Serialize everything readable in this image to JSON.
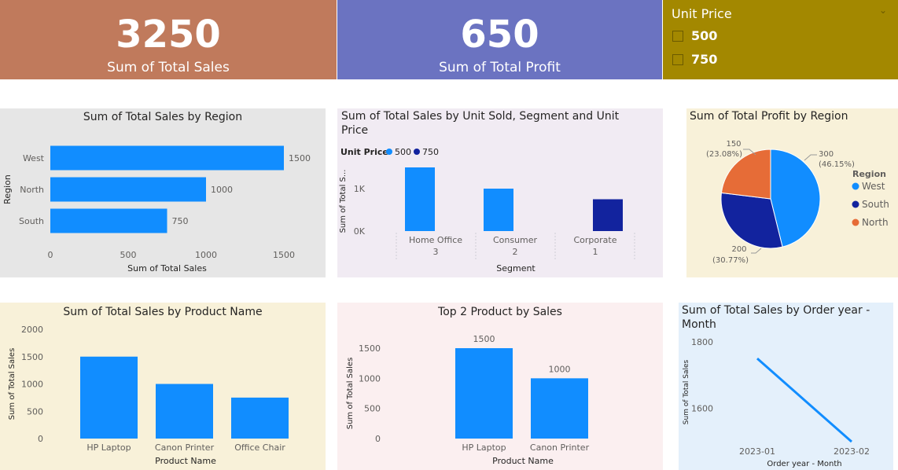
{
  "kpis": [
    {
      "value": "3250",
      "label": "Sum of Total Sales",
      "bg": "#c07a5c"
    },
    {
      "value": "650",
      "label": "Sum of Total Profit",
      "bg": "#6b73c1"
    }
  ],
  "slicer": {
    "title": "Unit Price",
    "items": [
      "500",
      "750"
    ],
    "bg": "#a38800"
  },
  "colors": {
    "blue": "#118dff",
    "dark_blue": "#12239e",
    "orange": "#e66c37"
  },
  "chart_data": [
    {
      "type": "bar",
      "orientation": "horizontal",
      "title": "Sum of Total Sales by Region",
      "categories": [
        "West",
        "North",
        "South"
      ],
      "values": [
        1500,
        1000,
        750
      ],
      "data_labels": [
        "1500",
        "1000",
        "750"
      ],
      "xlabel": "Sum of Total Sales",
      "ylabel": "Region",
      "xticks": [
        "0",
        "500",
        "1000",
        "1500"
      ],
      "xlim": [
        0,
        1500
      ]
    },
    {
      "type": "bar",
      "title": "Sum of Total Sales by Unit Sold, Segment and Unit Price",
      "legend_title": "Unit Price",
      "series": [
        {
          "name": "500",
          "values": [
            1500,
            1000,
            0
          ]
        },
        {
          "name": "750",
          "values": [
            0,
            0,
            750
          ]
        }
      ],
      "categories": [
        "Home Office",
        "Consumer",
        "Corporate"
      ],
      "subcategories": [
        "3",
        "2",
        "1"
      ],
      "xlabel": "Segment",
      "ylabel": "Sum of Total S...",
      "yticks": [
        "0K",
        "1K"
      ],
      "ylim": [
        0,
        1500
      ]
    },
    {
      "type": "pie",
      "title": "Sum of Total Profit by Region",
      "legend_title": "Region",
      "categories": [
        "West",
        "South",
        "North"
      ],
      "values": [
        300,
        200,
        150
      ],
      "value_labels": [
        "300",
        "200",
        "150"
      ],
      "percent_labels": [
        "(46.15%)",
        "(30.77%)",
        "(23.08%)"
      ]
    },
    {
      "type": "bar",
      "title": "Sum of Total Sales by Product Name",
      "categories": [
        "HP Laptop",
        "Canon Printer",
        "Office Chair"
      ],
      "values": [
        1500,
        1000,
        750
      ],
      "xlabel": "Product Name",
      "ylabel": "Sum of Total Sales",
      "yticks": [
        "0",
        "500",
        "1000",
        "1500",
        "2000"
      ],
      "ylim": [
        0,
        2000
      ]
    },
    {
      "type": "bar",
      "title": "Top 2 Product by Sales",
      "categories": [
        "HP Laptop",
        "Canon Printer"
      ],
      "values": [
        1500,
        1000
      ],
      "data_labels": [
        "1500",
        "1000"
      ],
      "xlabel": "Product Name",
      "ylabel": "Sum of Total Sales",
      "yticks": [
        "0",
        "500",
        "1000",
        "1500"
      ],
      "ylim": [
        0,
        1500
      ]
    },
    {
      "type": "line",
      "title": "Sum of Total Sales by Order year - Month",
      "x": [
        "2023-01",
        "2023-02"
      ],
      "values": [
        1750,
        1500
      ],
      "xlabel": "Order year - Month",
      "ylabel": "Sum of Total Sales",
      "yticks": [
        "1600",
        "1800"
      ],
      "ylim": [
        1500,
        1800
      ]
    }
  ]
}
